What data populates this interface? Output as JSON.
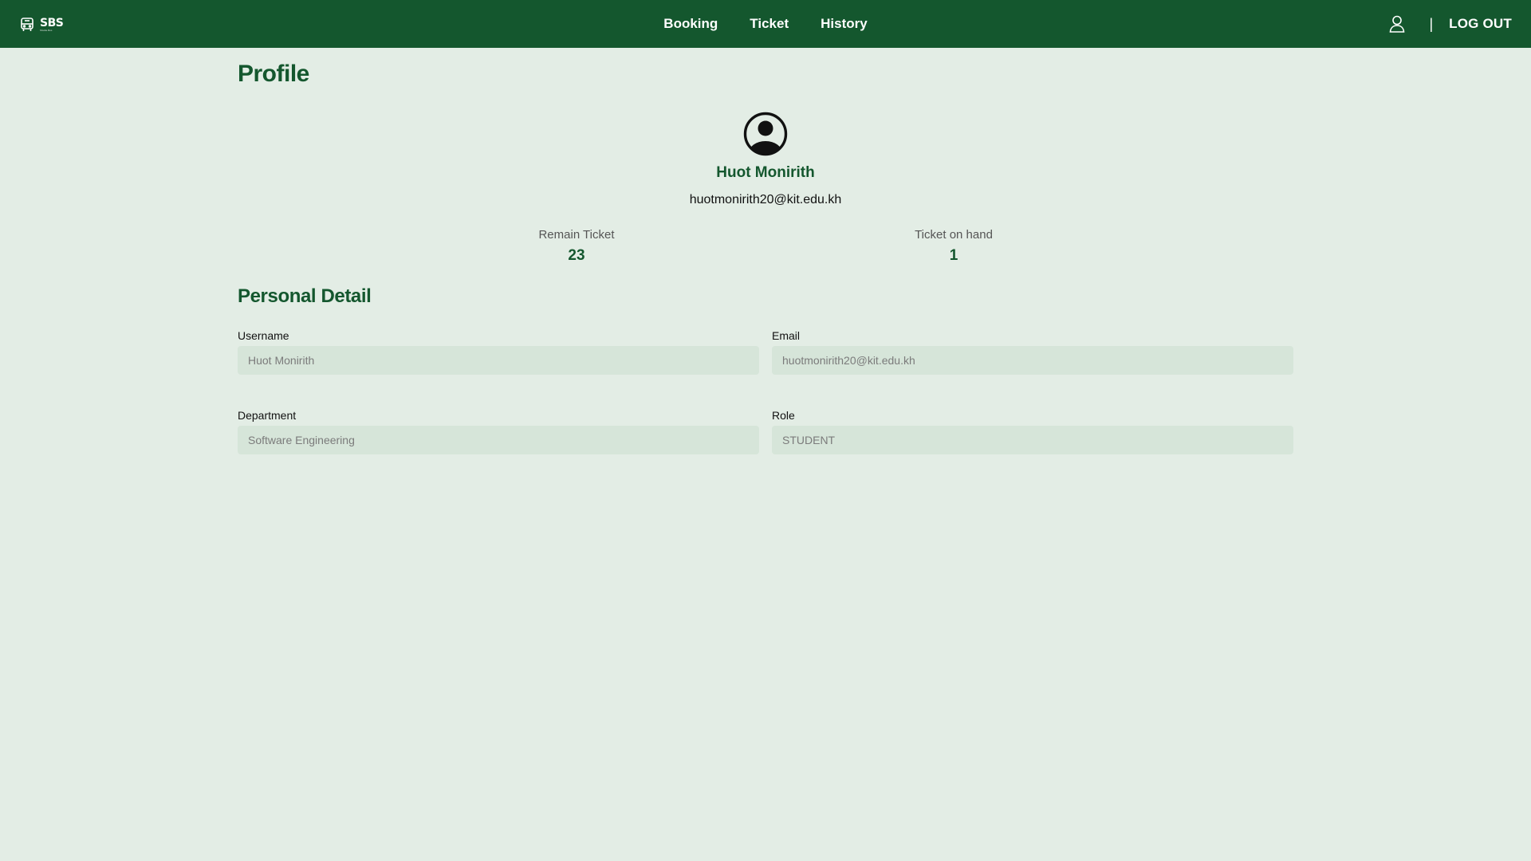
{
  "header": {
    "logo": {
      "title": "SBS",
      "subtitle": "Shuttle Bus",
      "icon": "bus-icon"
    },
    "nav": [
      {
        "label": "Booking"
      },
      {
        "label": "Ticket"
      },
      {
        "label": "History"
      }
    ],
    "user_icon": "user-icon",
    "separator": "|",
    "logout_label": "LOG OUT"
  },
  "profile": {
    "title": "Profile",
    "avatar_icon": "user-circle-icon",
    "name": "Huot Monirith",
    "email": "huotmonirith20@kit.edu.kh",
    "stats": [
      {
        "label": "Remain Ticket",
        "value": "23"
      },
      {
        "label": "Ticket on hand",
        "value": "1"
      }
    ]
  },
  "personal_detail": {
    "title": "Personal Detail",
    "fields": {
      "username": {
        "label": "Username",
        "value": "Huot Monirith"
      },
      "email": {
        "label": "Email",
        "value": "huotmonirith20@kit.edu.kh"
      },
      "department": {
        "label": "Department",
        "value": "Software Engineering"
      },
      "role": {
        "label": "Role",
        "value": "STUDENT"
      }
    }
  },
  "colors": {
    "brand": "#14572e",
    "background": "#e3ede5",
    "input_background": "#d6e5d9"
  }
}
